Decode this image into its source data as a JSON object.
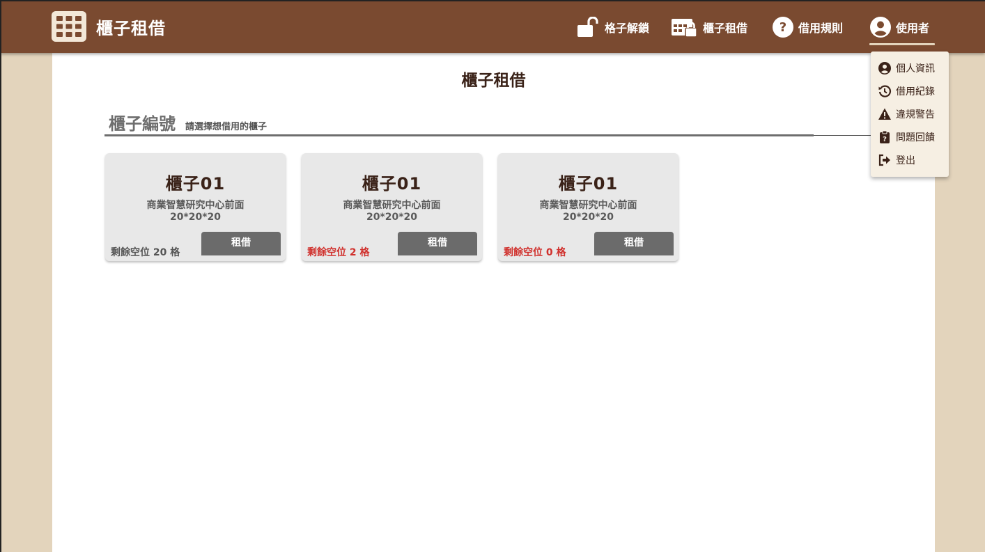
{
  "header": {
    "brand_title": "櫃子租借",
    "nav": [
      {
        "label": "格子解鎖",
        "icon": "unlock-icon"
      },
      {
        "label": "櫃子租借",
        "icon": "locker-lock-icon"
      },
      {
        "label": "借用規則",
        "icon": "help-circle-icon"
      },
      {
        "label": "使用者",
        "icon": "user-circle-icon"
      }
    ]
  },
  "page": {
    "title": "櫃子租借",
    "section_title": "櫃子編號",
    "section_hint": "請選擇想借用的櫃子"
  },
  "lockers": [
    {
      "name": "櫃子01",
      "location": "商業智慧研究中心前面",
      "size": "20*20*20",
      "remaining": "剩餘空位 20 格",
      "remaining_color": "#555555",
      "button": "租借"
    },
    {
      "name": "櫃子01",
      "location": "商業智慧研究中心前面",
      "size": "20*20*20",
      "remaining": "剩餘空位 2 格",
      "remaining_color": "#d0302c",
      "button": "租借"
    },
    {
      "name": "櫃子01",
      "location": "商業智慧研究中心前面",
      "size": "20*20*20",
      "remaining": "剩餘空位 0 格",
      "remaining_color": "#d0302c",
      "button": "租借"
    }
  ],
  "user_menu": {
    "items": [
      {
        "label": "個人資訊",
        "icon": "user-circle-icon"
      },
      {
        "label": "借用紀錄",
        "icon": "history-icon"
      },
      {
        "label": "違規警告",
        "icon": "warning-icon"
      },
      {
        "label": "問題回饋",
        "icon": "clipboard-question-icon"
      },
      {
        "label": "登出",
        "icon": "logout-icon"
      }
    ]
  },
  "colors": {
    "header_bg": "#7a4a30",
    "page_bg": "#e3d4bc",
    "card_bg": "#e8e8e8",
    "button_bg": "#6b6b6b",
    "warning_text": "#d0302c"
  }
}
